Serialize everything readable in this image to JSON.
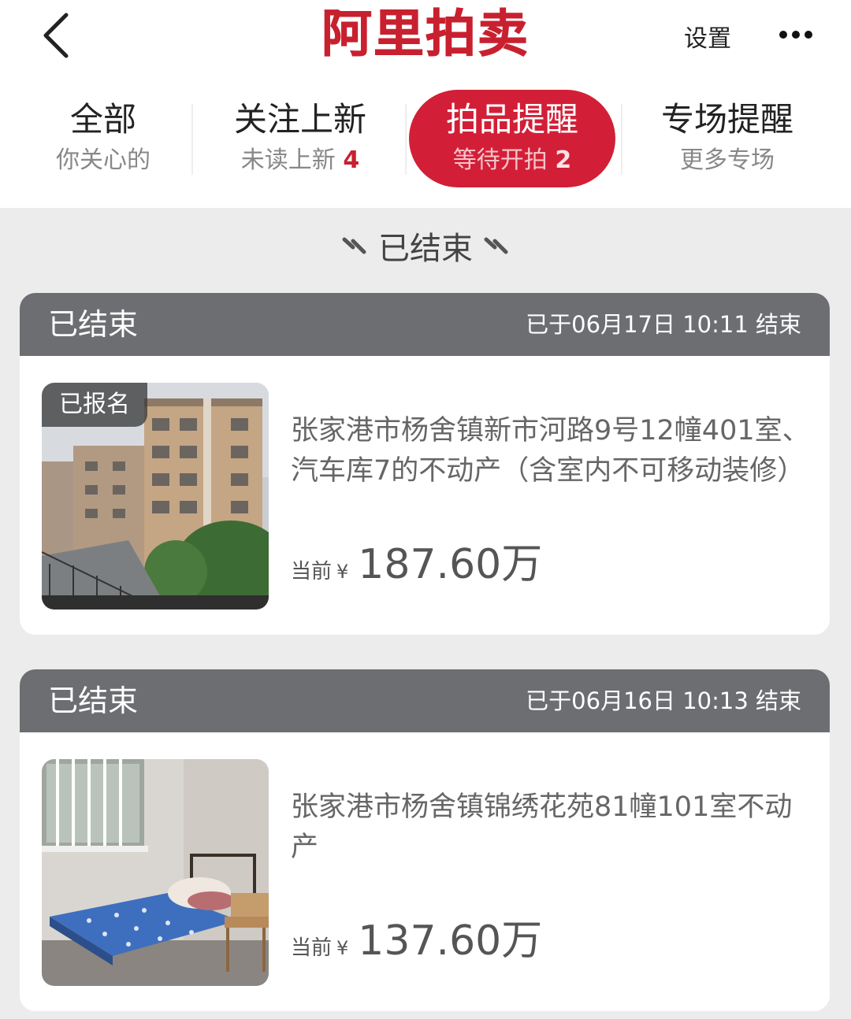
{
  "header": {
    "logo": "阿里拍卖",
    "settings_label": "设置"
  },
  "tabs": [
    {
      "title": "全部",
      "sub": "你关心的",
      "count": ""
    },
    {
      "title": "关注上新",
      "sub": "未读上新",
      "count": "4"
    },
    {
      "title": "拍品提醒",
      "sub": "等待开拍",
      "count": "2"
    },
    {
      "title": "专场提醒",
      "sub": "更多专场",
      "count": ""
    }
  ],
  "active_tab_index": 2,
  "section_heading": "已结束",
  "cards": [
    {
      "status": "已结束",
      "end_time": "已于06月17日 10:11 结束",
      "badge": "已报名",
      "title": "张家港市杨舍镇新市河路9号12幢401室、汽车库7的不动产（含室内不可移动装修）",
      "price_label": "当前",
      "currency": "¥",
      "price": "187.60万",
      "image": "apartment-building-photo"
    },
    {
      "status": "已结束",
      "end_time": "已于06月16日 10:13 结束",
      "badge": "",
      "title": "张家港市杨舍镇锦绣花苑81幢101室不动产",
      "price_label": "当前",
      "currency": "¥",
      "price": "137.60万",
      "image": "bedroom-interior-photo"
    }
  ],
  "colors": {
    "brand_red": "#d21f37",
    "card_header_gray": "#6c6e72",
    "page_bg": "#ececec"
  }
}
